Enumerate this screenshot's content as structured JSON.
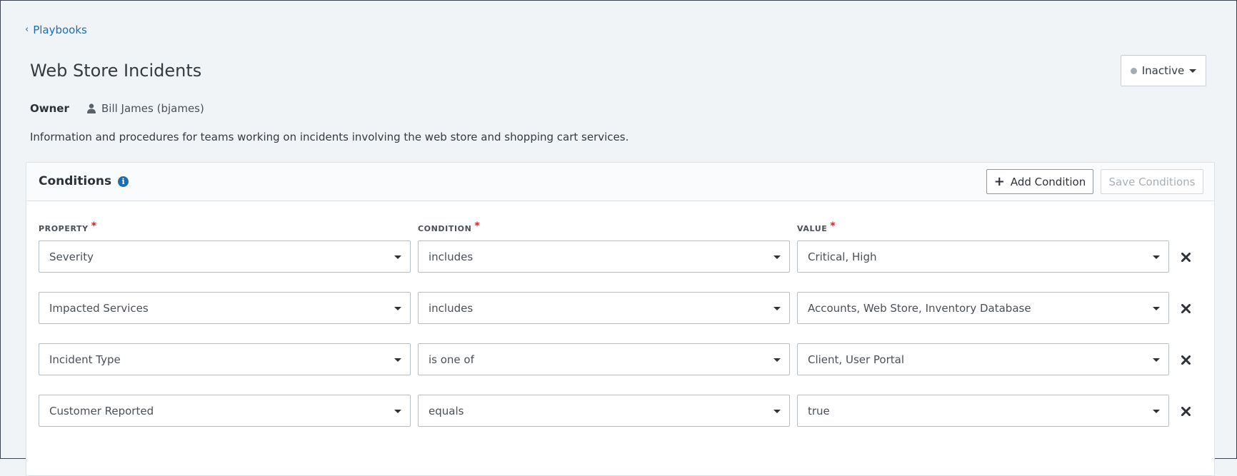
{
  "breadcrumb": {
    "back_label": "Playbooks"
  },
  "header": {
    "title": "Web Store Incidents",
    "status": "Inactive"
  },
  "owner": {
    "label": "Owner",
    "value": "Bill James (bjames)"
  },
  "description": "Information and procedures for teams working on incidents involving the web store and shopping cart services.",
  "conditions_panel": {
    "title": "Conditions",
    "add_label": "Add Condition",
    "save_label": "Save Conditions",
    "columns": {
      "property": "PROPERTY",
      "condition": "CONDITION",
      "value": "VALUE"
    },
    "rows": [
      {
        "property": "Severity",
        "condition": "includes",
        "value": "Critical, High"
      },
      {
        "property": "Impacted Services",
        "condition": "includes",
        "value": "Accounts, Web Store, Inventory Database"
      },
      {
        "property": "Incident Type",
        "condition": "is one of",
        "value": "Client, User Portal"
      },
      {
        "property": "Customer Reported",
        "condition": "equals",
        "value": "true"
      }
    ]
  },
  "colors": {
    "link": "#1a6fb3",
    "required": "#d0202c",
    "status_dot": "#a3acb5",
    "background": "#f1f4f7"
  }
}
